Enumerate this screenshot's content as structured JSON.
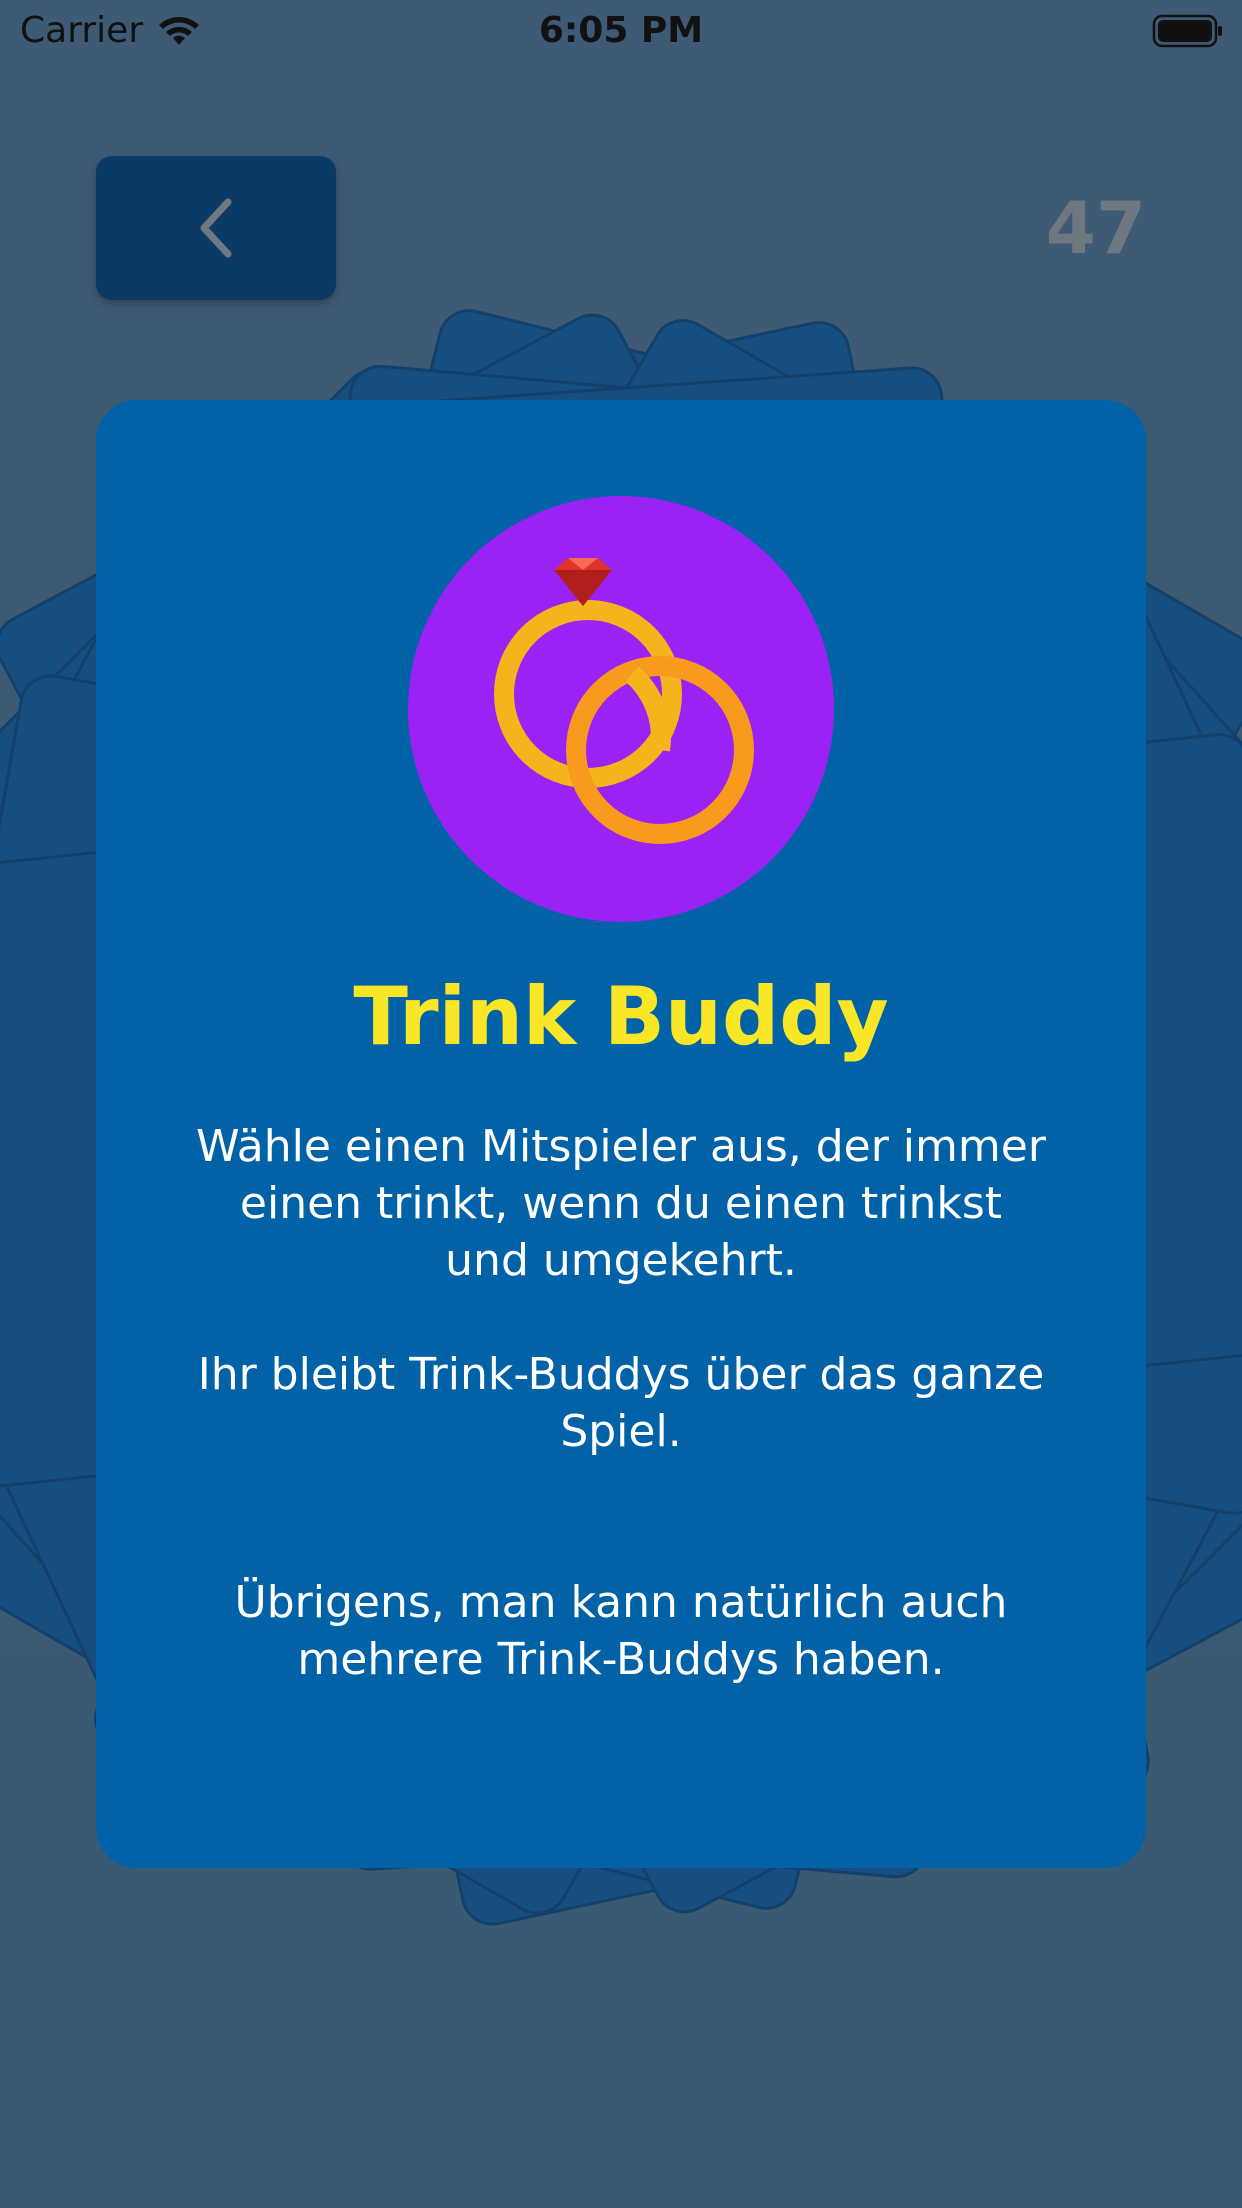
{
  "status_bar": {
    "carrier": "Carrier",
    "time": "6:05 PM"
  },
  "header": {
    "back_icon": "chevron-left-icon",
    "counter": "47"
  },
  "card": {
    "icon": "wedding-rings-icon",
    "title": "Trink Buddy",
    "paragraphs": [
      "Wähle einen Mitspieler aus, der immer einen trinkt, wenn du einen trinkst und umgekehrt.",
      "Ihr bleibt Trink-Buddys über das ganze Spiel.",
      "Übrigens, man kann natürlich auch mehrere Trink-Buddys haben."
    ]
  },
  "colors": {
    "background": "#3f5a74",
    "card": "#0262a8",
    "back_button": "#0c3a66",
    "title": "#f8e627",
    "icon_circle": "#9a22f5",
    "counter": "#6f7780"
  }
}
